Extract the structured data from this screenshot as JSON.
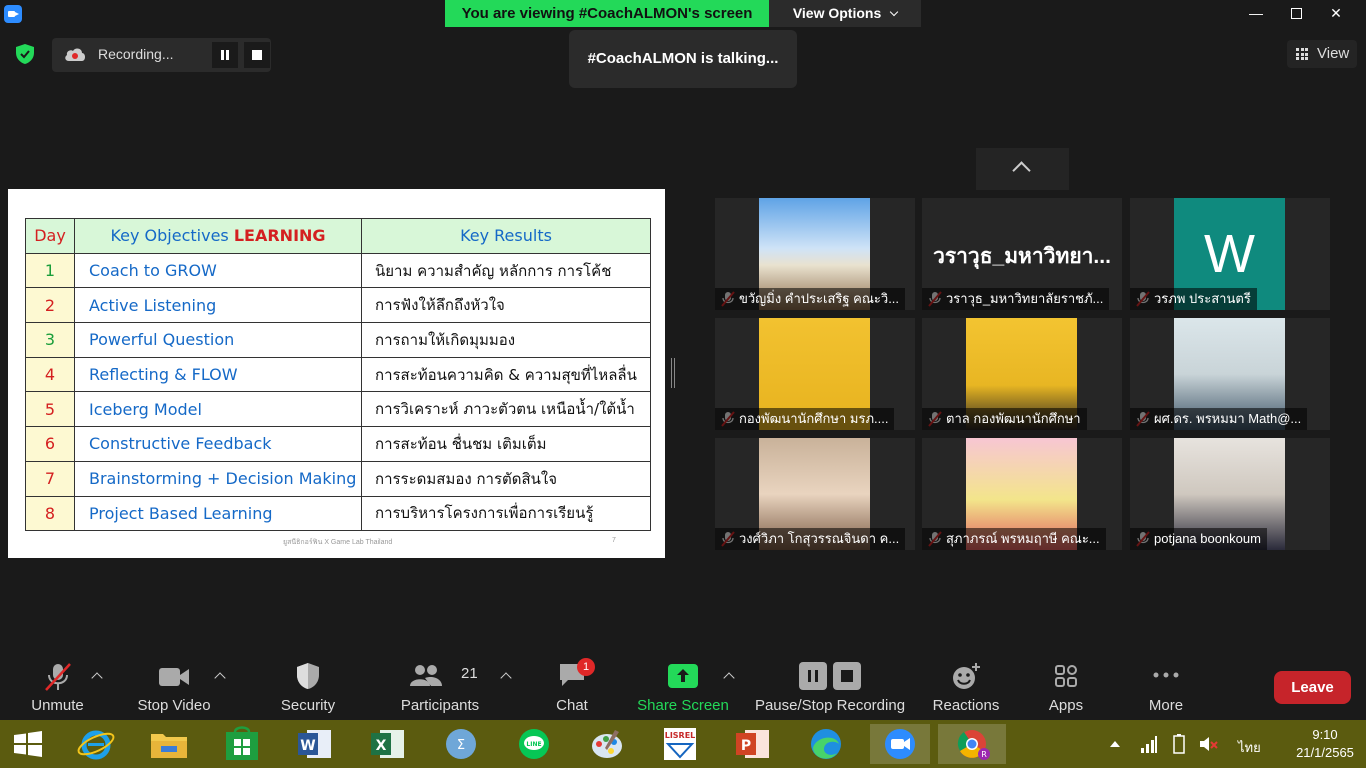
{
  "title_bar": {
    "viewing_banner": "You are viewing #CoachALMON's screen",
    "view_options": "View Options"
  },
  "recording": {
    "label": "Recording..."
  },
  "talking_indicator": "#CoachALMON is talking...",
  "view_button": "View",
  "slide": {
    "headers": {
      "day": "Day",
      "objectives_prefix": "Key Objectives ",
      "objectives_highlight": "LEARNING",
      "results": "Key Results"
    },
    "rows": [
      {
        "day": "1",
        "objective": "Coach to GROW",
        "result": "นิยาม ความสำคัญ หลักการ การโค้ช"
      },
      {
        "day": "2",
        "objective": "Active Listening",
        "result": "การฟังให้ลึกถึงหัวใจ"
      },
      {
        "day": "3",
        "objective": "Powerful Question",
        "result": "การถามให้เกิดมุมมอง"
      },
      {
        "day": "4",
        "objective": "Reflecting & FLOW",
        "result": "การสะท้อนความคิด & ความสุขที่ไหลลื่น"
      },
      {
        "day": "5",
        "objective": "Iceberg Model",
        "result": "การวิเคราะห์ ภาวะตัวตน เหนือน้ำ/ใต้น้ำ"
      },
      {
        "day": "6",
        "objective": "Constructive Feedback",
        "result": "การสะท้อน ชื่นชม เติมเต็ม"
      },
      {
        "day": "7",
        "objective": "Brainstorming + Decision Making",
        "result": "การระดมสมอง การตัดสินใจ"
      },
      {
        "day": "8",
        "objective": "Project Based Learning",
        "result": "การบริหารโครงการเพื่อการเรียนรู้"
      }
    ],
    "day_colors": [
      "#1a9e3a",
      "#d42020",
      "#1a9e3a",
      "#d42020",
      "#d42020",
      "#d42020",
      "#d42020",
      "#d42020"
    ],
    "footer": "ยูสนีธิกอร์ฟิน X Game Lab Thailand",
    "page_number": "7"
  },
  "participants": [
    {
      "name": "ขวัญมิ่ง คำประเสริฐ คณะวิ..."
    },
    {
      "name": "วราวุธ_มหาวิทยาลัยราชภั...",
      "display_name": "วราวุธ_มหาวิทยา..."
    },
    {
      "name": "วรภพ ประสานตรี",
      "avatar_letter": "W"
    },
    {
      "name": "กองพัฒนานักศึกษา มรภ...."
    },
    {
      "name": "ตาล กองพัฒนานักศึกษา"
    },
    {
      "name": "ผศ.ดร. พรหมมา Math@..."
    },
    {
      "name": "วงศ์วิภา โกสุวรรณจินดา ค..."
    },
    {
      "name": "สุภาภรณ์ พรหมฤาษี คณะ..."
    },
    {
      "name": "potjana boonkoum"
    }
  ],
  "toolbar": {
    "unmute": "Unmute",
    "stop_video": "Stop Video",
    "security": "Security",
    "participants": "Participants",
    "participants_count": "21",
    "chat": "Chat",
    "chat_badge": "1",
    "share_screen": "Share Screen",
    "pause_stop_recording": "Pause/Stop Recording",
    "reactions": "Reactions",
    "apps": "Apps",
    "more": "More",
    "leave": "Leave"
  },
  "taskbar": {
    "lang": "ไทย",
    "time": "9:10",
    "date": "21/1/2565"
  },
  "colors": {
    "share_green": "#23d959",
    "leave_red": "#c6242a",
    "taskbar": "#5b5b0f",
    "slide_header_bg": "#d8f7d8",
    "slide_blue": "#1569c7"
  }
}
